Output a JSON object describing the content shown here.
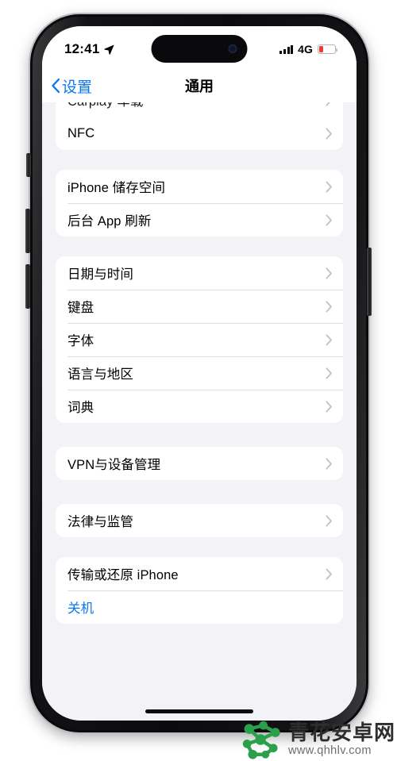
{
  "status_bar": {
    "time": "12:41",
    "location_icon": "location-arrow-icon",
    "signal_icon": "cellular-bars-icon",
    "network": "4G",
    "battery_icon": "battery-low-icon",
    "battery_color": "#f03b36"
  },
  "nav": {
    "back_label": "设置",
    "back_icon": "chevron-left-icon",
    "title": "通用"
  },
  "groups": [
    {
      "id": "group-nfc",
      "clipped": true,
      "rows": [
        {
          "label": "Carplay 车载",
          "clipped": true,
          "chevron": true
        },
        {
          "label": "NFC",
          "chevron": true
        }
      ]
    },
    {
      "id": "group-storage",
      "rows": [
        {
          "label": "iPhone 储存空间",
          "chevron": true
        },
        {
          "label": "后台 App 刷新",
          "chevron": true
        }
      ]
    },
    {
      "id": "group-datetime",
      "rows": [
        {
          "label": "日期与时间",
          "chevron": true
        },
        {
          "label": "键盘",
          "chevron": true
        },
        {
          "label": "字体",
          "chevron": true
        },
        {
          "label": "语言与地区",
          "chevron": true
        },
        {
          "label": "词典",
          "chevron": true
        }
      ]
    },
    {
      "id": "group-vpn",
      "highlighted": true,
      "rows": [
        {
          "label": "VPN与设备管理",
          "chevron": true
        }
      ]
    },
    {
      "id": "group-legal",
      "rows": [
        {
          "label": "法律与监管",
          "chevron": true
        }
      ]
    },
    {
      "id": "group-reset",
      "rows": [
        {
          "label": "传输或还原 iPhone",
          "chevron": true
        },
        {
          "label": "关机",
          "chevron": false,
          "accent": true
        }
      ]
    }
  ],
  "highlight": {
    "color": "#ef4450",
    "target": "VPN与设备管理"
  },
  "watermark": {
    "name": "青花安卓网",
    "url": "www.qhhlv.com",
    "logo_color": "#2aa04a"
  }
}
